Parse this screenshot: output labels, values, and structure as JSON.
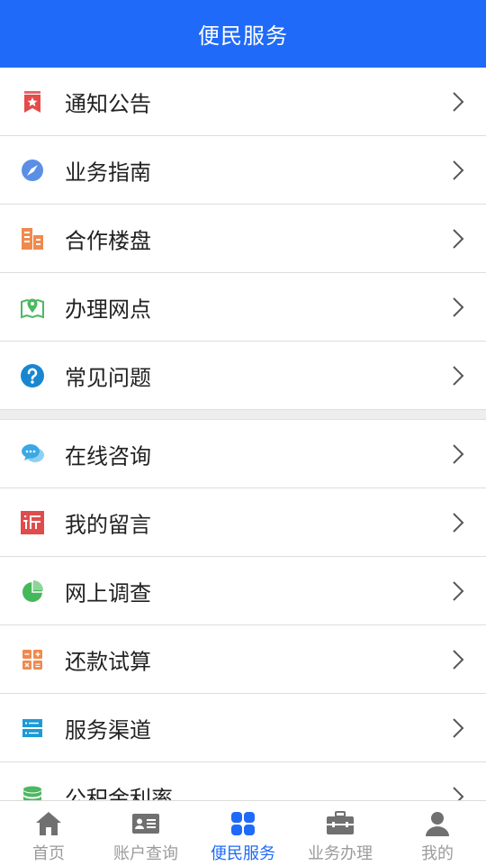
{
  "header": {
    "title": "便民服务"
  },
  "colors": {
    "accent": "#1f6af8",
    "tab_inactive": "#9b9b9b"
  },
  "list": {
    "group1": [
      {
        "label": "通知公告",
        "icon": "bookmark-icon"
      },
      {
        "label": "业务指南",
        "icon": "compass-icon"
      },
      {
        "label": "合作楼盘",
        "icon": "building-icon"
      },
      {
        "label": "办理网点",
        "icon": "map-pin-icon"
      },
      {
        "label": "常见问题",
        "icon": "question-icon"
      }
    ],
    "group2": [
      {
        "label": "在线咨询",
        "icon": "chat-bubble-icon"
      },
      {
        "label": "我的留言",
        "icon": "complaint-icon"
      },
      {
        "label": "网上调查",
        "icon": "pie-chart-icon"
      },
      {
        "label": "还款试算",
        "icon": "calculator-icon"
      },
      {
        "label": "服务渠道",
        "icon": "server-icon"
      },
      {
        "label": "公积金利率",
        "icon": "coins-stack-icon"
      }
    ]
  },
  "tabbar": [
    {
      "label": "首页",
      "icon": "home-icon"
    },
    {
      "label": "账户查询",
      "icon": "id-card-icon"
    },
    {
      "label": "便民服务",
      "icon": "grid-icon",
      "active": true
    },
    {
      "label": "业务办理",
      "icon": "briefcase-icon"
    },
    {
      "label": "我的",
      "icon": "user-icon"
    }
  ]
}
